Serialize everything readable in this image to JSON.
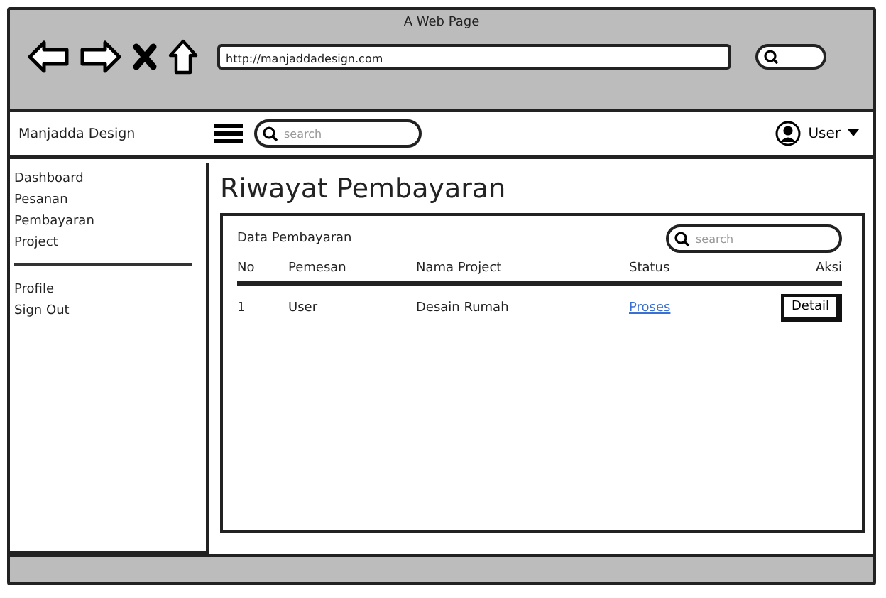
{
  "window": {
    "title": "A Web Page",
    "url": "http://manjaddadesign.com"
  },
  "header": {
    "brand": "Manjadda Design",
    "search_placeholder": "search",
    "user": "User"
  },
  "sidebar": {
    "groups": [
      {
        "items": [
          "Dashboard",
          "Pesanan",
          "Pembayaran",
          "Project"
        ]
      },
      {
        "items": [
          "Profile",
          "Sign Out"
        ]
      }
    ]
  },
  "page": {
    "title": "Riwayat Pembayaran",
    "panel": {
      "title": "Data Pembayaran",
      "search_placeholder": "search",
      "table": {
        "columns": [
          "No",
          "Pemesan",
          "Nama Project",
          "Status",
          "Aksi"
        ],
        "rows": [
          {
            "no": "1",
            "pemesan": "User",
            "project": "Desain Rumah",
            "status": "Proses",
            "action": "Detail"
          }
        ]
      }
    }
  }
}
